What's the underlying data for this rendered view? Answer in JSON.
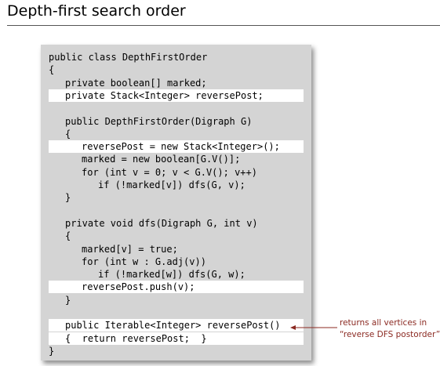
{
  "slide": {
    "title": "Depth-first search order"
  },
  "code": {
    "lines": [
      {
        "text": "public class DepthFirstOrder",
        "indent": 0,
        "hl": false
      },
      {
        "text": "{",
        "indent": 0,
        "hl": false
      },
      {
        "text": "private boolean[] marked;",
        "indent": 1,
        "hl": false
      },
      {
        "text": "private Stack<Integer> reversePost;",
        "indent": 1,
        "hl": true
      },
      {
        "text": "",
        "indent": 0,
        "hl": false
      },
      {
        "text": "public DepthFirstOrder(Digraph G)",
        "indent": 1,
        "hl": false
      },
      {
        "text": "{",
        "indent": 1,
        "hl": false
      },
      {
        "text": "reversePost = new Stack<Integer>();",
        "indent": 2,
        "hl": true
      },
      {
        "text": "marked = new boolean[G.V()];",
        "indent": 2,
        "hl": false
      },
      {
        "text": "for (int v = 0; v < G.V(); v++)",
        "indent": 2,
        "hl": false
      },
      {
        "text": "if (!marked[v]) dfs(G, v);",
        "indent": 3,
        "hl": false
      },
      {
        "text": "}",
        "indent": 1,
        "hl": false
      },
      {
        "text": "",
        "indent": 0,
        "hl": false
      },
      {
        "text": "private void dfs(Digraph G, int v)",
        "indent": 1,
        "hl": false
      },
      {
        "text": "{",
        "indent": 1,
        "hl": false
      },
      {
        "text": "marked[v] = true;",
        "indent": 2,
        "hl": false
      },
      {
        "text": "for (int w : G.adj(v))",
        "indent": 2,
        "hl": false
      },
      {
        "text": "if (!marked[w]) dfs(G, w);",
        "indent": 3,
        "hl": false
      },
      {
        "text": "reversePost.push(v);",
        "indent": 2,
        "hl": true
      },
      {
        "text": "}",
        "indent": 1,
        "hl": false
      },
      {
        "text": "",
        "indent": 0,
        "hl": false
      },
      {
        "text": "public Iterable<Integer> reversePost()",
        "indent": 1,
        "hl": true
      },
      {
        "text": "{  return reversePost;  }",
        "indent": 1,
        "hl": true
      },
      {
        "text": "}",
        "indent": 0,
        "hl": false
      }
    ]
  },
  "annotation": {
    "line1": "returns all vertices in",
    "line2": "“reverse DFS postorder”",
    "color": "#8b2a22"
  }
}
